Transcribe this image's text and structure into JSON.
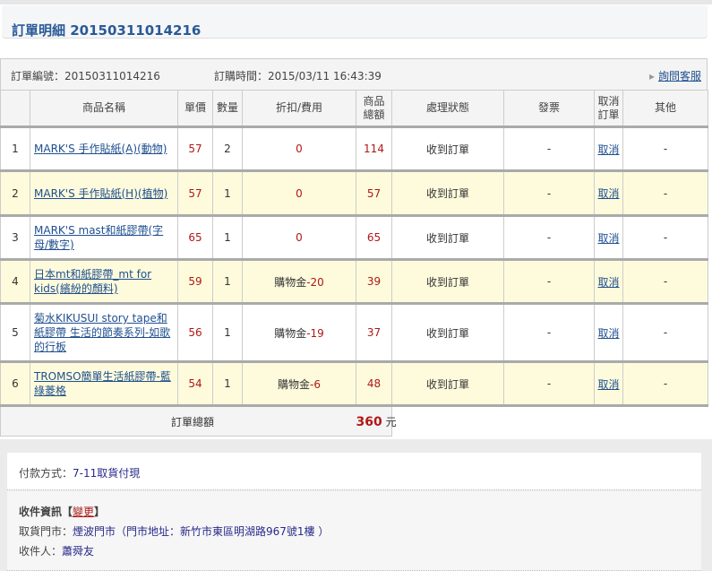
{
  "header": {
    "title": "訂單明細 20150311014216"
  },
  "order": {
    "number_label": "訂單編號：",
    "number": "20150311014216",
    "time_label": "訂購時間：",
    "time": "2015/03/11 16:43:39",
    "contact_link": "詢問客服"
  },
  "table": {
    "headers": [
      "",
      "商品名稱",
      "單價",
      "數量",
      "折扣/費用",
      "商品總額",
      "處理狀態",
      "發票",
      "取消訂單",
      "其他"
    ],
    "rows": [
      {
        "idx": "1",
        "name": "MARK'S 手作貼紙(A)(動物)",
        "price": "57",
        "qty": "2",
        "disc_label": "",
        "disc": "0",
        "total": "114",
        "status": "收到訂單",
        "invoice": "-",
        "cancel": "取消",
        "other": "-"
      },
      {
        "idx": "2",
        "name": "MARK'S 手作貼紙(H)(植物)",
        "price": "57",
        "qty": "1",
        "disc_label": "",
        "disc": "0",
        "total": "57",
        "status": "收到訂單",
        "invoice": "-",
        "cancel": "取消",
        "other": "-"
      },
      {
        "idx": "3",
        "name": "MARK'S mast和紙膠帶(字母/數字)",
        "price": "65",
        "qty": "1",
        "disc_label": "",
        "disc": "0",
        "total": "65",
        "status": "收到訂單",
        "invoice": "-",
        "cancel": "取消",
        "other": "-"
      },
      {
        "idx": "4",
        "name": "日本mt和紙膠帶_mt for kids(繽紛的顏料)",
        "price": "59",
        "qty": "1",
        "disc_label": "購物金",
        "disc": "-20",
        "total": "39",
        "status": "收到訂單",
        "invoice": "-",
        "cancel": "取消",
        "other": "-"
      },
      {
        "idx": "5",
        "name": "菊水KIKUSUI story tape和紙膠帶 生活的節奏系列-如歌的行板",
        "price": "56",
        "qty": "1",
        "disc_label": "購物金",
        "disc": "-19",
        "total": "37",
        "status": "收到訂單",
        "invoice": "-",
        "cancel": "取消",
        "other": "-"
      },
      {
        "idx": "6",
        "name": "TROMSO簡單生活紙膠帶-藍綠菱格",
        "price": "54",
        "qty": "1",
        "disc_label": "購物金",
        "disc": "-6",
        "total": "48",
        "status": "收到訂單",
        "invoice": "-",
        "cancel": "取消",
        "other": "-"
      }
    ],
    "total_label": "訂單總額",
    "total_value": "360",
    "currency": "元"
  },
  "payment": {
    "label": "付款方式：",
    "value": "7-11取貨付現"
  },
  "shipping": {
    "title": "收件資訊【",
    "change": "變更",
    "title_end": "】",
    "store_label": "取貨門市：",
    "store": "煙波門市（門市地址：新竹市東區明湖路967號1樓 ）",
    "recipient_label": "收件人：",
    "recipient": "蕭舜友"
  }
}
